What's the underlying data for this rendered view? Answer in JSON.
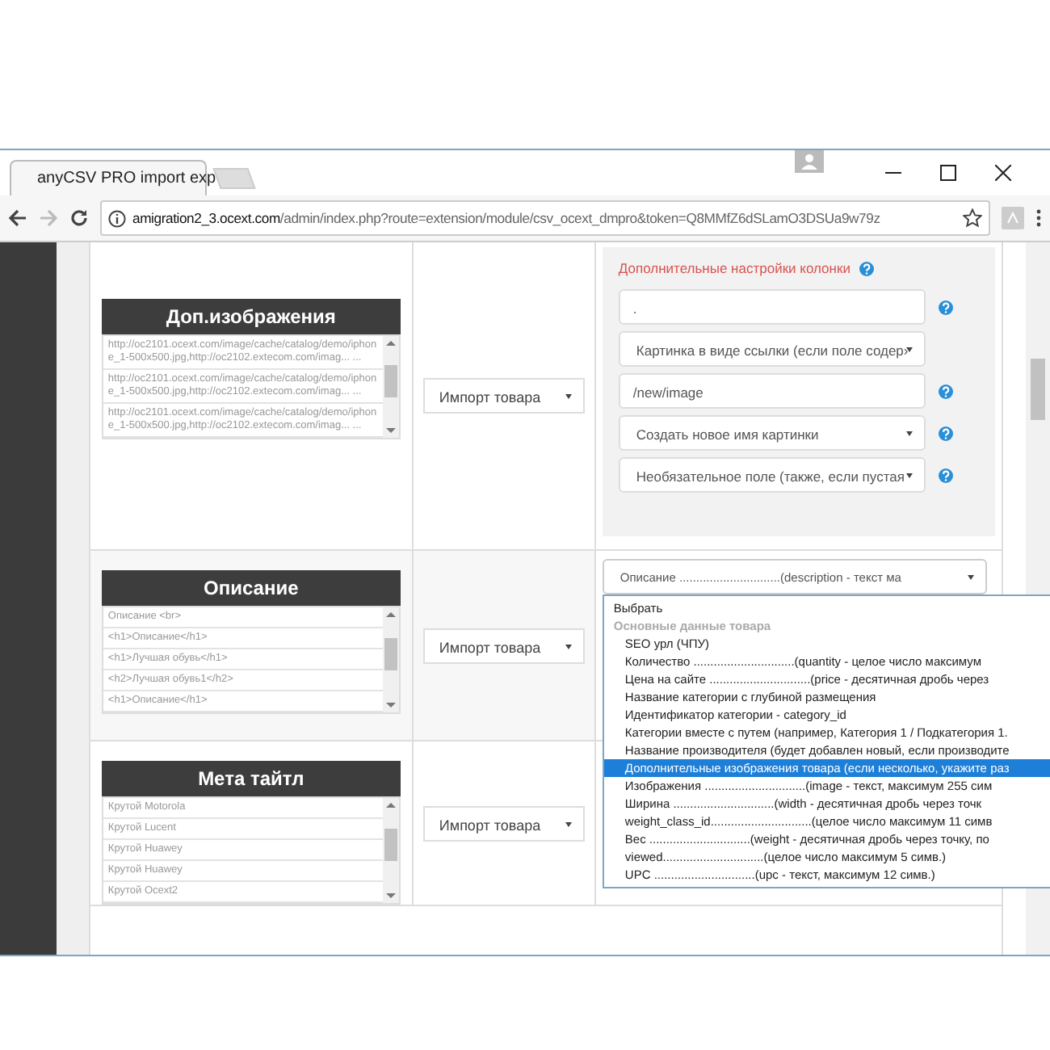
{
  "browser": {
    "tab_title": "anyCSV PRO import exp",
    "url_host": "amigration2_3.ocext.com",
    "url_path": "/admin/index.php?route=extension/module/csv_ocext_dmpro&token=Q8MMfZ6dSLamO3DSUa9w79z"
  },
  "rows": [
    {
      "header": "Доп.изображения",
      "samples": [
        "http://oc2101.ocext.com/image/cache/catalog/demo/iphone_1-500x500.jpg,http://oc2102.extecom.com/imag... ...",
        "http://oc2101.ocext.com/image/cache/catalog/demo/iphone_1-500x500.jpg,http://oc2102.extecom.com/imag... ...",
        "http://oc2101.ocext.com/image/cache/catalog/demo/iphone_1-500x500.jpg,http://oc2102.extecom.com/imag... ..."
      ],
      "mode": "Импорт товара",
      "settings": {
        "title": "Дополнительные настройки колонки",
        "fields": [
          {
            "kind": "input",
            "value": ".",
            "help": true
          },
          {
            "kind": "select",
            "value": "Картинка в виде ссылки (если поле содер›",
            "help": false
          },
          {
            "kind": "input",
            "value": "/new/image",
            "help": true
          },
          {
            "kind": "select",
            "value": "Создать новое имя картинки",
            "help": true
          },
          {
            "kind": "select",
            "value": "Необязательное поле (также, если пустая",
            "help": true
          }
        ]
      }
    },
    {
      "header": "Описание",
      "samples": [
        "Описание <br>",
        "<h1>Описание</h1>",
        "<h1>Лучшая обувь</h1>",
        "<h2>Лучшая обувь1</h2>",
        "<h1>Описание</h1>"
      ],
      "mode": "Импорт товара",
      "field_select": {
        "value": "Описание ..............................(description - текст ма",
        "open": true,
        "first_option": {
          "label": "Выбрать",
          "selected": false
        },
        "groups": [
          {
            "label": "Основные данные товара",
            "options": [
              {
                "label": "SEO урл (ЧПУ)",
                "selected": false
              },
              {
                "label": "Количество ..............................(quantity - целое число максимум",
                "selected": false
              },
              {
                "label": "Цена на сайте ..............................(price - десятичная дробь через",
                "selected": false
              },
              {
                "label": "Название категории с глубиной размещения",
                "selected": false
              },
              {
                "label": "Идентификатор категории - category_id",
                "selected": false
              },
              {
                "label": "Категории вместе с путем (например, Категория 1 / Подкатегория 1.",
                "selected": false
              },
              {
                "label": "Название производителя (будет добавлен новый, если производите",
                "selected": false
              },
              {
                "label": "Дополнительные изображения товара (если несколько, укажите раз",
                "selected": true
              },
              {
                "label": "Изображения ..............................(image - текст, максимум 255 сим",
                "selected": false
              },
              {
                "label": "Ширина ..............................(width - десятичная дробь через точк",
                "selected": false
              },
              {
                "label": "weight_class_id..............................(целое число максимум 11 симв",
                "selected": false
              },
              {
                "label": "Вес ..............................(weight - десятичная дробь через точку, по",
                "selected": false
              },
              {
                "label": "viewed..............................(целое число максимум 5 симв.)",
                "selected": false
              },
              {
                "label": "UPC ..............................(upc - текст, максимум 12 симв.)",
                "selected": false
              }
            ]
          }
        ]
      }
    },
    {
      "header": "Мета тайтл",
      "samples": [
        "Крутой Motorola",
        "Крутой Lucent",
        "Крутой Huawey",
        "Крутой Huawey",
        "Крутой Ocext2"
      ],
      "mode": "Импорт товара"
    }
  ]
}
